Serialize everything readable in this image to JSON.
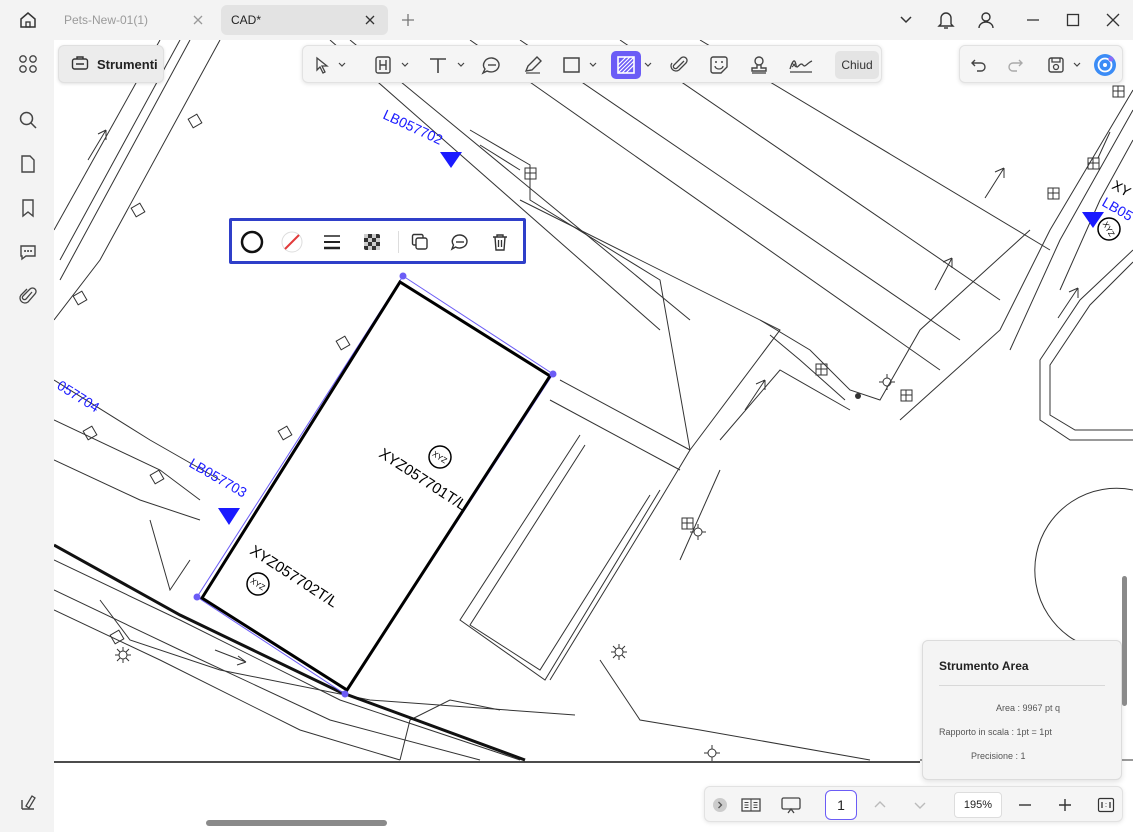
{
  "titlebar": {
    "tabs": [
      {
        "label": "Pets-New-01(1)",
        "active": false
      },
      {
        "label": "CAD*",
        "active": true
      }
    ]
  },
  "sidebar": {
    "items": [
      "apps-icon",
      "search-icon",
      "page-icon",
      "bookmark-icon",
      "comment-icon",
      "attachment-icon",
      "settings-icon"
    ]
  },
  "toolbar": {
    "strumenti_label": "Strumenti",
    "chiud_label": "Chiud"
  },
  "drawing": {
    "labels": {
      "lb1": "LB057702",
      "lb2": "LB057703",
      "lb3": "057704",
      "lb4": "LB05",
      "xy_right": "XY",
      "xyz1": "XYZ057701T/L",
      "xyz2": "XYZ057702T/L",
      "badge": "XYZ"
    }
  },
  "info_panel": {
    "title": "Strumento Area",
    "area": "Area : 9967 pt q",
    "scale": "Rapporto in scala : 1pt = 1pt",
    "precision": "Precisione : 1"
  },
  "navbar": {
    "page": "1",
    "zoom": "195%"
  },
  "colors": {
    "accent": "#6b5cf6",
    "selection_border": "#2f3fc9",
    "annotation_blue": "#1a1aff"
  }
}
